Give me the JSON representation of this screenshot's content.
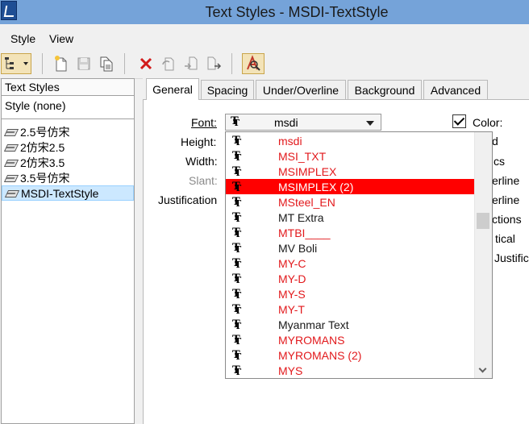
{
  "window": {
    "title": "Text Styles - MSDI-TextStyle"
  },
  "menu": {
    "style": "Style",
    "view": "View"
  },
  "toolbar": {
    "icons": [
      "hierarchy-dropdown-icon",
      "new-style-icon",
      "save-icon",
      "copy-icon",
      "delete-icon",
      "reset-icon",
      "import-icon",
      "export-icon",
      "match-text-style-icon"
    ]
  },
  "left_pane": {
    "header": "Text Styles",
    "none_item": "Style (none)",
    "items": [
      {
        "label": "2.5号仿宋",
        "selected": false
      },
      {
        "label": "2仿宋2.5",
        "selected": false
      },
      {
        "label": "2仿宋3.5",
        "selected": false
      },
      {
        "label": "3.5号仿宋",
        "selected": false
      },
      {
        "label": "MSDI-TextStyle",
        "selected": true
      }
    ]
  },
  "tabs": [
    {
      "label": "General",
      "active": true
    },
    {
      "label": "Spacing",
      "active": false
    },
    {
      "label": "Under/Overline",
      "active": false
    },
    {
      "label": "Background",
      "active": false
    },
    {
      "label": "Advanced",
      "active": false
    }
  ],
  "general": {
    "font_label": "Font:",
    "font_value": "msdi",
    "height_label": "Height:",
    "width_label": "Width:",
    "slant_label": "Slant:",
    "justification_label": "Justification",
    "color_label": "Color:",
    "color_checked": true,
    "right_partial": [
      "d",
      "cs",
      "erline",
      "erline",
      "ctions",
      "tical",
      "Justific"
    ]
  },
  "font_dropdown": {
    "items": [
      {
        "name": "msdi",
        "color": "red"
      },
      {
        "name": "MSI_TXT",
        "color": "red"
      },
      {
        "name": "MSIMPLEX",
        "color": "red"
      },
      {
        "name": "MSIMPLEX (2)",
        "color": "red",
        "selected": true
      },
      {
        "name": "MSteel_EN",
        "color": "red"
      },
      {
        "name": "MT Extra",
        "color": "black"
      },
      {
        "name": "MTBI____",
        "color": "red"
      },
      {
        "name": "MV Boli",
        "color": "black"
      },
      {
        "name": "MY-C",
        "color": "red"
      },
      {
        "name": "MY-D",
        "color": "red"
      },
      {
        "name": "MY-S",
        "color": "red"
      },
      {
        "name": "MY-T",
        "color": "red"
      },
      {
        "name": "Myanmar Text",
        "color": "black"
      },
      {
        "name": "MYROMANS",
        "color": "red"
      },
      {
        "name": "MYROMANS (2)",
        "color": "red"
      },
      {
        "name": "MYS",
        "color": "red"
      }
    ]
  },
  "colors": {
    "selection": "#ff0000",
    "titlebar": "#75a3d9",
    "list_selection": "#cce8ff"
  }
}
